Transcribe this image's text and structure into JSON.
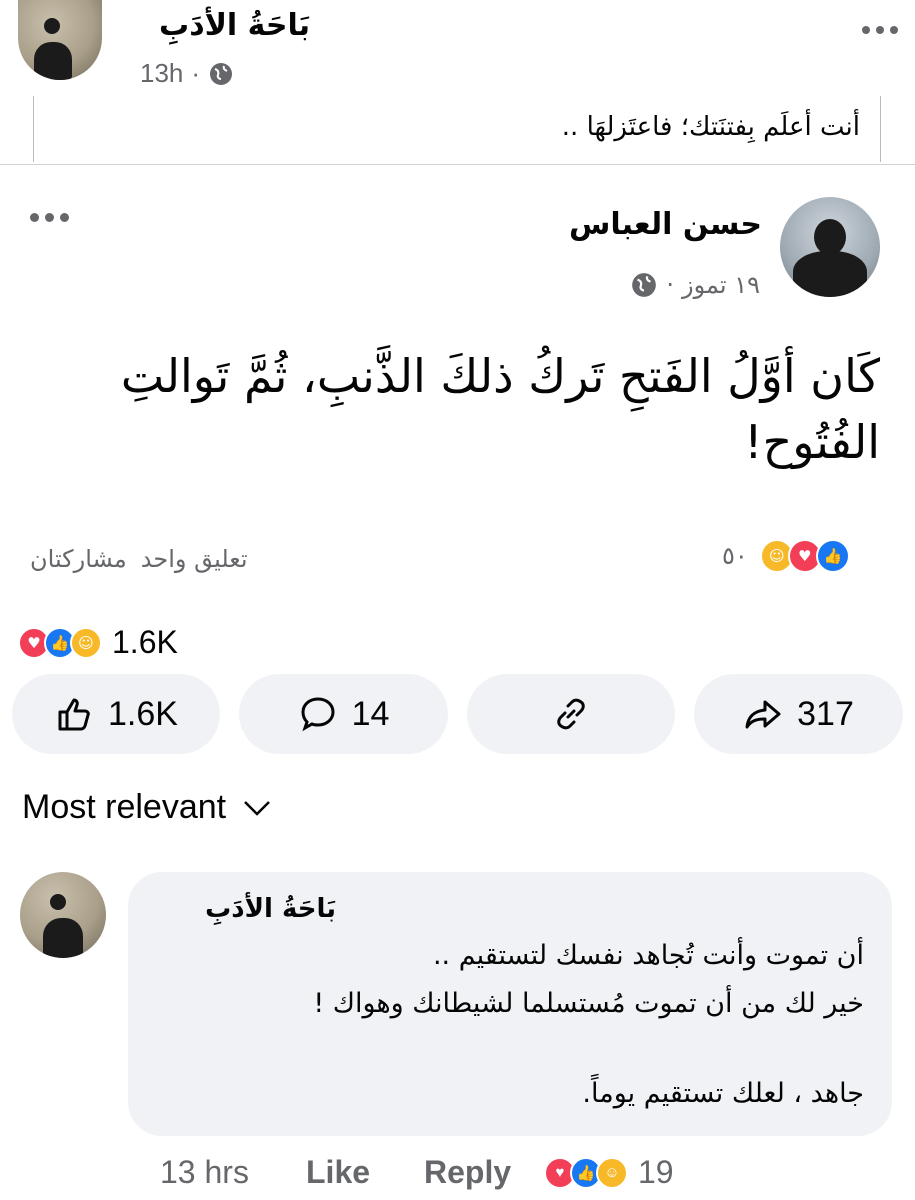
{
  "post": {
    "page_name": "بَاحَةُ الأدَبِ",
    "time": "13h",
    "separator": "·",
    "privacy_icon": "globe-icon",
    "caption": "أنت أعلَم بِفتنَتك؛ فاعتَزلهَا .."
  },
  "shared_post": {
    "author": "حسن العباس",
    "date": "١٩ تموز",
    "separator": "·",
    "privacy_icon": "globe-icon",
    "text": "كَان أوَّلُ الفَتحِ تَركُ ذلكَ الذَّنبِ، ثُمَّ تَوالتِ الفُتُوح!",
    "reaction_count": "٥٠",
    "comments": "تعليق واحد",
    "shares": "مشاركتان"
  },
  "stats": {
    "reactions_total": "1.6K"
  },
  "actions": {
    "like_count": "1.6K",
    "comment_count": "14",
    "share_count": "317"
  },
  "sort": {
    "label": "Most relevant"
  },
  "comment": {
    "author": "بَاحَةُ الأدَبِ",
    "line1": "أن تموت وأنت تُجاهد نفسك لتستقيم ..",
    "line2": "خير لك من أن تموت مُستسلما لشيطانك وهواك !",
    "line3": "جاهد ، لعلك تستقيم يوماً.",
    "time": "13 hrs",
    "like_label": "Like",
    "reply_label": "Reply",
    "reaction_count": "19"
  },
  "colors": {
    "like_blue": "#1877f2",
    "love_red": "#f33e58",
    "care_yellow": "#f7b928",
    "muted_text": "#65676b",
    "bubble_bg": "#f0f2f5"
  }
}
